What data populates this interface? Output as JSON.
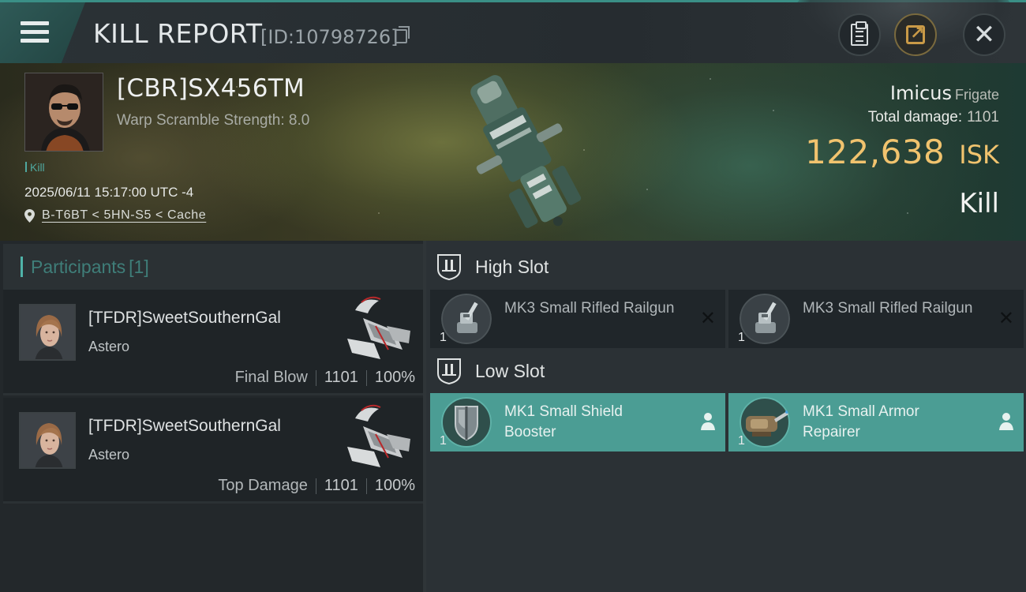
{
  "header": {
    "title": "KILL REPORT",
    "report_id": "[ID:10798726]"
  },
  "victim": {
    "name": "[CBR]SX456TM",
    "warp_scramble": "Warp Scramble Strength: 8.0",
    "kill_tag": "Kill",
    "datetime": "2025/06/11 15:17:00 UTC -4",
    "location": "B-T6BT < 5HN-S5 < Cache",
    "ship_name": "Imicus",
    "ship_class": "Frigate",
    "total_damage_label": "Total damage:",
    "total_damage_value": "1101",
    "isk_value": "122,638",
    "isk_unit": "ISK",
    "result": "Kill"
  },
  "participants": {
    "label": "Participants",
    "count": "[1]",
    "items": [
      {
        "name": "[TFDR]SweetSouthernGal",
        "ship": "Astero",
        "role": "Final Blow",
        "damage": "1101",
        "percent": "100%"
      },
      {
        "name": "[TFDR]SweetSouthernGal",
        "ship": "Astero",
        "role": "Top Damage",
        "damage": "1101",
        "percent": "100%"
      }
    ]
  },
  "fitting": {
    "high_slot_label": "High Slot",
    "low_slot_label": "Low Slot",
    "high": [
      {
        "name": "MK3 Small Rifled Railgun",
        "qty": "1"
      },
      {
        "name": "MK3 Small Rifled Railgun",
        "qty": "1"
      }
    ],
    "low": [
      {
        "name": "MK1 Small Shield Booster",
        "qty": "1"
      },
      {
        "name": "MK1 Small Armor Repairer",
        "qty": "1"
      }
    ]
  },
  "colors": {
    "accent_teal": "#4fb3a9",
    "isk_gold": "#f1c36e",
    "low_slot_fitted": "#4b9d94",
    "panel_dark": "#23282b"
  },
  "icons": {
    "menu": "hamburger-menu-icon",
    "copy": "copy-icon",
    "clipboard": "clipboard-icon",
    "share": "share-icon",
    "close": "close-icon",
    "location": "location-pin-icon",
    "slot": "slot-shield-icon",
    "destroyed": "destroyed-x-icon",
    "dropped": "person-icon"
  }
}
